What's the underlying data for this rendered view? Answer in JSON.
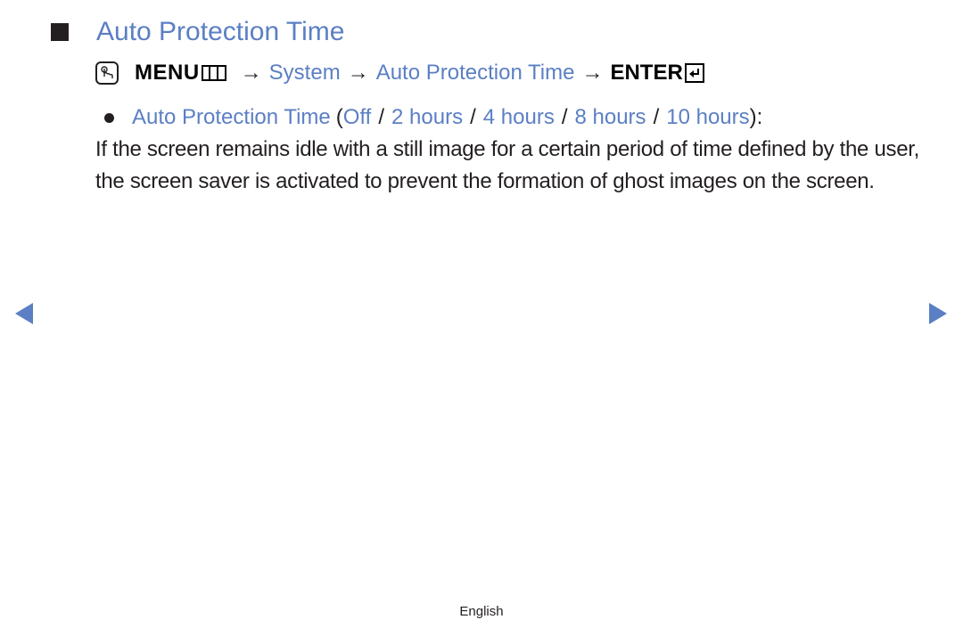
{
  "page": {
    "title": "Auto Protection Time",
    "path": {
      "icon": "om-hand-icon",
      "menu_label": "MENU",
      "menu_icon": "menu-grid-icon",
      "arrow": "→",
      "steps": [
        "System",
        "Auto Protection Time"
      ],
      "enter_label": "ENTER",
      "enter_icon": "enter-icon"
    },
    "option": {
      "name": "Auto Protection Time",
      "open_paren": "(",
      "values": [
        "Off",
        "2 hours",
        "4 hours",
        "8 hours",
        "10 hours"
      ],
      "separator": "/",
      "close": "):"
    },
    "description": "If the screen remains idle with a still image for a certain period of time defined by the user, the screen saver is activated to prevent the formation of ghost images on the screen."
  },
  "navigation": {
    "prev_icon": "prev-page-triangle-icon",
    "next_icon": "next-page-triangle-icon"
  },
  "footer": {
    "language": "English"
  },
  "colors": {
    "accent": "#5b7fc4",
    "text": "#231f20"
  }
}
